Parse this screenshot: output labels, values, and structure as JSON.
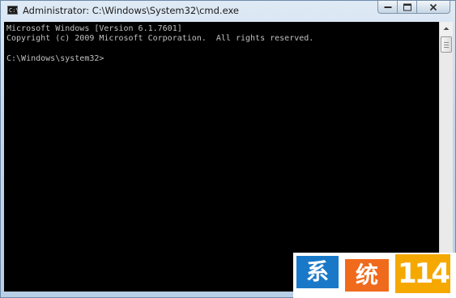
{
  "window": {
    "title": "Administrator: C:\\Windows\\System32\\cmd.exe",
    "icon": "cmd-console-icon",
    "icon_glyph": "C:\\",
    "controls": [
      "minimize-icon",
      "restore-icon",
      "close-icon"
    ]
  },
  "console": {
    "lines": [
      "Microsoft Windows [Version 6.1.7601]",
      "Copyright (c) 2009 Microsoft Corporation.  All rights reserved.",
      "",
      "C:\\Windows\\system32>"
    ],
    "background_color": "#000000",
    "text_color": "#c0c0c0"
  },
  "scrollbar": {
    "up_icon": "scroll-up-arrow-icon",
    "down_icon": "scroll-down-arrow-icon"
  },
  "watermark": {
    "char1": "系",
    "char2": "统",
    "number": "114",
    "colors": {
      "blue": "#1979c8",
      "orange": "#f06a1c",
      "yellow": "#f5a800"
    }
  }
}
